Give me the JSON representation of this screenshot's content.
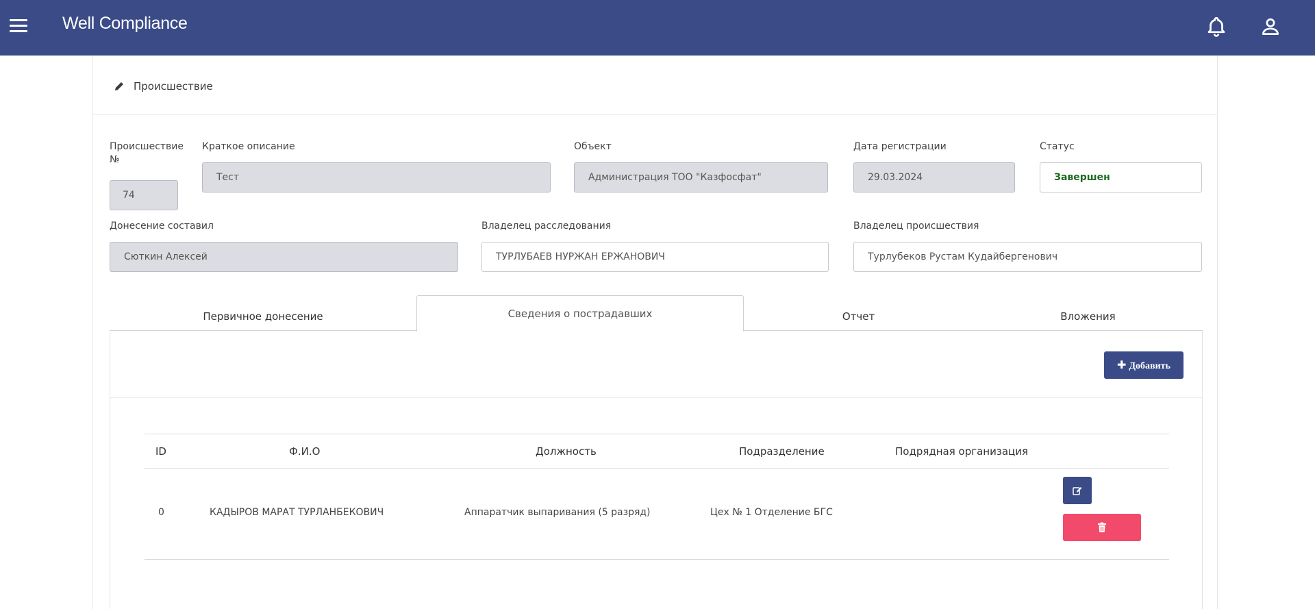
{
  "app": {
    "title": "Well Compliance"
  },
  "card": {
    "title": "Происшествие"
  },
  "form": {
    "incident_no": {
      "label": "Происшествие №",
      "value": "74"
    },
    "short_description": {
      "label": "Краткое описание",
      "value": "Тест"
    },
    "object": {
      "label": "Объект",
      "value": "Администрация ТОО \"Казфосфат\""
    },
    "registration_date": {
      "label": "Дата регистрации",
      "value": "29.03.2024"
    },
    "status": {
      "label": "Статус",
      "value": "Завершен",
      "color": "#1d6b22"
    },
    "reported_by": {
      "label": "Донесение составил",
      "value": "Сюткин Алексей"
    },
    "investigation_owner": {
      "label": "Владелец расследования",
      "value": "ТУРЛУБАЕВ НУРЖАН ЕРЖАНОВИЧ"
    },
    "incident_owner": {
      "label": "Владелец происшествия",
      "value": "Турлубеков Рустам Кудайбергенович"
    }
  },
  "tabs": [
    {
      "label": "Первичное донесение",
      "active": false
    },
    {
      "label": "Сведения о пострадавших",
      "active": true
    },
    {
      "label": "Отчет",
      "active": false
    },
    {
      "label": "Вложения",
      "active": false
    }
  ],
  "toolbar": {
    "add_label": "Добавить"
  },
  "table": {
    "columns": [
      "ID",
      "Ф.И.О",
      "Должность",
      "Подразделение",
      "Подрядная организация"
    ],
    "rows": [
      {
        "id": "0",
        "name": "КАДЫРОВ МАРАТ ТУРЛАНБЕКОВИЧ",
        "position": "Аппаратчик выпаривания (5 разряд)",
        "department": "Цех № 1 Отделение БГС",
        "contractor": ""
      }
    ]
  },
  "colors": {
    "primary": "#3a4b87",
    "danger": "#f24a6b",
    "status_done": "#1d6b22"
  },
  "icons": [
    "menu-icon",
    "bell-icon",
    "user-icon",
    "pencil-icon",
    "plus-icon",
    "edit-icon",
    "trash-icon"
  ]
}
